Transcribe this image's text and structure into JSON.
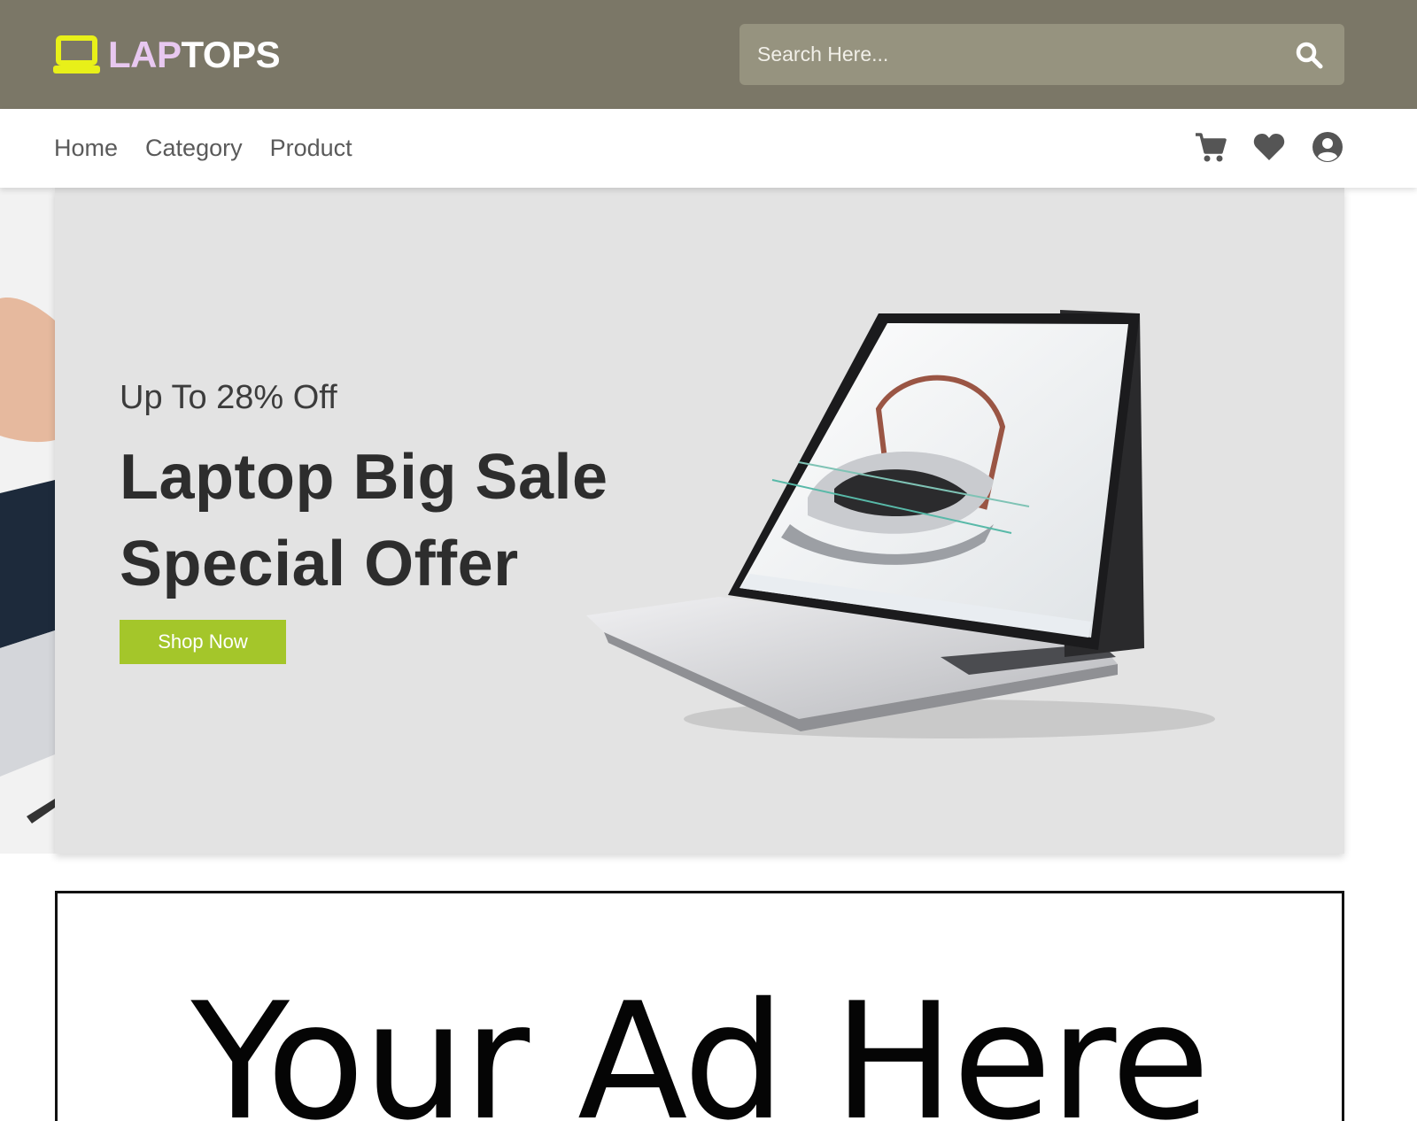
{
  "brand": {
    "name_part_a": "LAP",
    "name_part_b": "TOPS",
    "accent_color": "#e8f019",
    "header_color": "#7b7767"
  },
  "search": {
    "placeholder": "Search Here...",
    "icon": "search-icon"
  },
  "nav": {
    "links": [
      {
        "label": "Home"
      },
      {
        "label": "Category"
      },
      {
        "label": "Product"
      }
    ],
    "icons": [
      "cart-icon",
      "heart-icon",
      "user-icon"
    ]
  },
  "hero": {
    "subtitle": "Up To 28% Off",
    "title_line1": "Laptop Big Sale",
    "title_line2": "Special Offer",
    "cta_label": "Shop Now",
    "cta_color": "#a4c62a"
  },
  "ad": {
    "text": "Your Ad Here"
  }
}
